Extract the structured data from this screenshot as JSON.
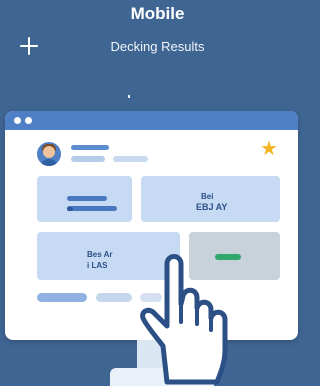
{
  "header": {
    "title": "Mobile",
    "subtitle": "Decking Results"
  },
  "cards": {
    "top_right_line1": "Bei",
    "top_right_line2": "EBJ AY",
    "bottom_left_line1": "Bes Ar",
    "bottom_left_line2": "i LAS"
  },
  "icons": [
    "plus-icon",
    "star-icon",
    "avatar",
    "hand-pointer-icon"
  ],
  "colors": {
    "background": "#3f6593",
    "titlebar": "#4f80c6",
    "card": "#c6daf4",
    "accent_green": "#31a86b",
    "star": "#f2b623"
  }
}
